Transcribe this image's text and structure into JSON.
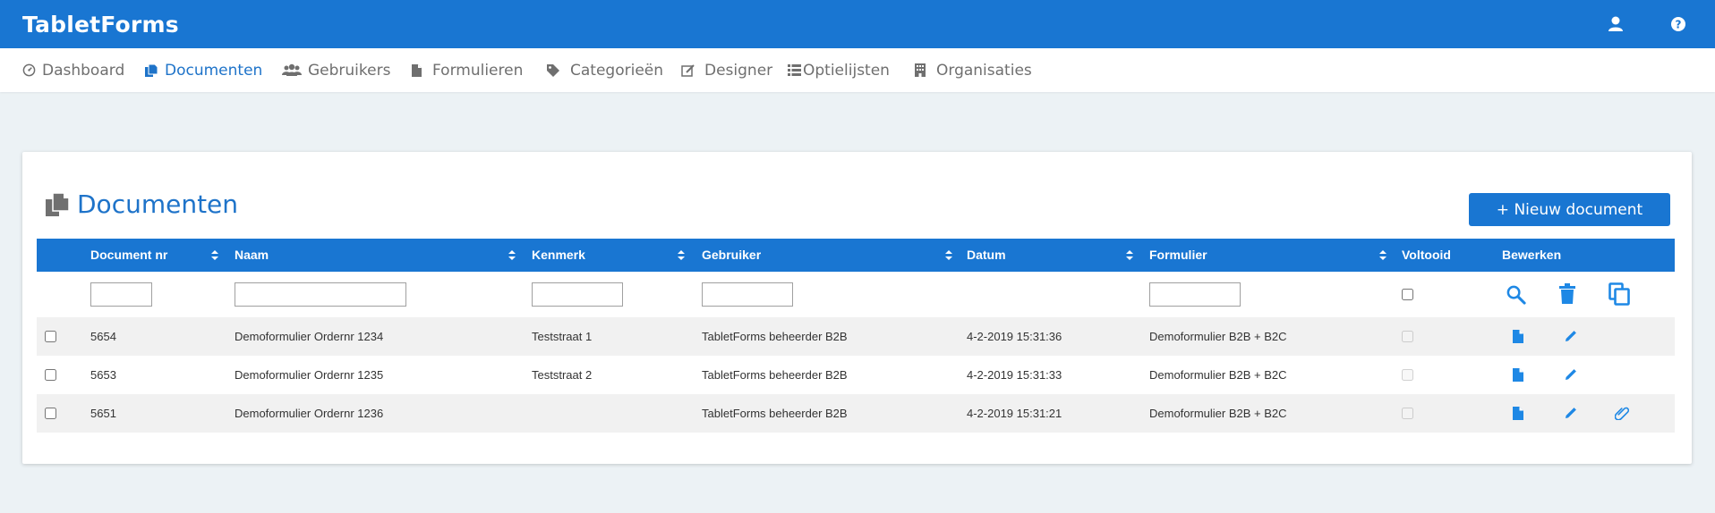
{
  "app": {
    "title": "TabletForms"
  },
  "header": {
    "user_icon": "user-icon",
    "help_icon": "help-icon"
  },
  "nav": {
    "items": [
      {
        "label": "Dashboard",
        "icon": "dashboard-icon",
        "active": false
      },
      {
        "label": "Documenten",
        "icon": "documents-icon",
        "active": true
      },
      {
        "label": "Gebruikers",
        "icon": "users-icon",
        "active": false
      },
      {
        "label": "Formulieren",
        "icon": "file-icon",
        "active": false
      },
      {
        "label": "Categorieën",
        "icon": "tag-icon",
        "active": false
      },
      {
        "label": "Designer",
        "icon": "edit-icon",
        "active": false
      },
      {
        "label": "Optielijsten",
        "icon": "list-icon",
        "active": false
      },
      {
        "label": "Organisaties",
        "icon": "building-icon",
        "active": false
      }
    ]
  },
  "page": {
    "title": "Documenten",
    "new_button": "+ Nieuw document"
  },
  "table": {
    "columns": [
      "Document nr",
      "Naam",
      "Kenmerk",
      "Gebruiker",
      "Datum",
      "Formulier",
      "Voltooid",
      "Bewerken"
    ],
    "filter_actions": [
      "search-icon",
      "trash-icon",
      "copy-icon"
    ],
    "rows": [
      {
        "nr": "5654",
        "naam": "Demoformulier Ordernr 1234",
        "kenmerk": "Teststraat 1",
        "gebruiker": "TabletForms beheerder B2B",
        "datum": "4-2-2019 15:31:36",
        "formulier": "Demoformulier B2B + B2C",
        "voltooid": false,
        "attachment": false
      },
      {
        "nr": "5653",
        "naam": "Demoformulier Ordernr 1235",
        "kenmerk": "Teststraat 2",
        "gebruiker": "TabletForms beheerder B2B",
        "datum": "4-2-2019 15:31:33",
        "formulier": "Demoformulier B2B + B2C",
        "voltooid": false,
        "attachment": false
      },
      {
        "nr": "5651",
        "naam": "Demoformulier Ordernr 1236",
        "kenmerk": "",
        "gebruiker": "TabletForms beheerder B2B",
        "datum": "4-2-2019 15:31:21",
        "formulier": "Demoformulier B2B + B2C",
        "voltooid": false,
        "attachment": true
      }
    ]
  },
  "colors": {
    "primary": "#1976d2",
    "title": "#1e73c9",
    "action": "#1e88e5",
    "background": "#ecf2f5"
  }
}
